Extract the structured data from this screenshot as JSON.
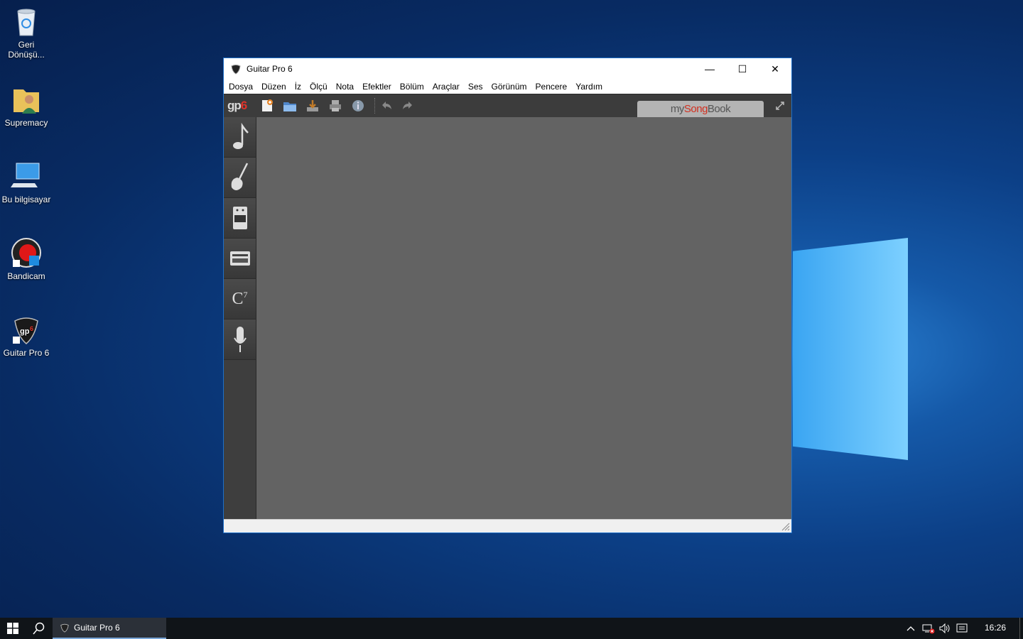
{
  "desktop": {
    "icons": [
      {
        "label": "Geri\nDönüşü...",
        "icon": "recycle-bin-icon"
      },
      {
        "label": "Supremacy",
        "icon": "user-folder-icon"
      },
      {
        "label": "Bu bilgisayar",
        "icon": "computer-icon"
      },
      {
        "label": "Bandicam",
        "icon": "bandicam-icon"
      },
      {
        "label": "Guitar Pro 6",
        "icon": "guitar-pro-icon"
      }
    ]
  },
  "window": {
    "title": "Guitar Pro 6",
    "controls": {
      "minimize": "—",
      "maximize": "☐",
      "close": "✕"
    },
    "menu": [
      "Dosya",
      "Düzen",
      "İz",
      "Ölçü",
      "Nota",
      "Efektler",
      "Bölüm",
      "Araçlar",
      "Ses",
      "Görünüm",
      "Pencere",
      "Yardım"
    ],
    "toolbar": {
      "logo_main": "gp",
      "logo_num": "6",
      "songbook_my": "my",
      "songbook_song": "Song",
      "songbook_book": "Book"
    },
    "sidebar": [
      "note-icon",
      "guitar-icon",
      "amp-icon",
      "keyboard-icon",
      "chord-icon",
      "microphone-icon"
    ],
    "chord_label": "C",
    "chord_sup": "7"
  },
  "taskbar": {
    "task_label": "Guitar Pro 6",
    "clock": "16:26"
  },
  "colors": {
    "toolbar_bg": "#3c3c3c",
    "main_bg": "#636363",
    "accent_red": "#e0332a"
  }
}
